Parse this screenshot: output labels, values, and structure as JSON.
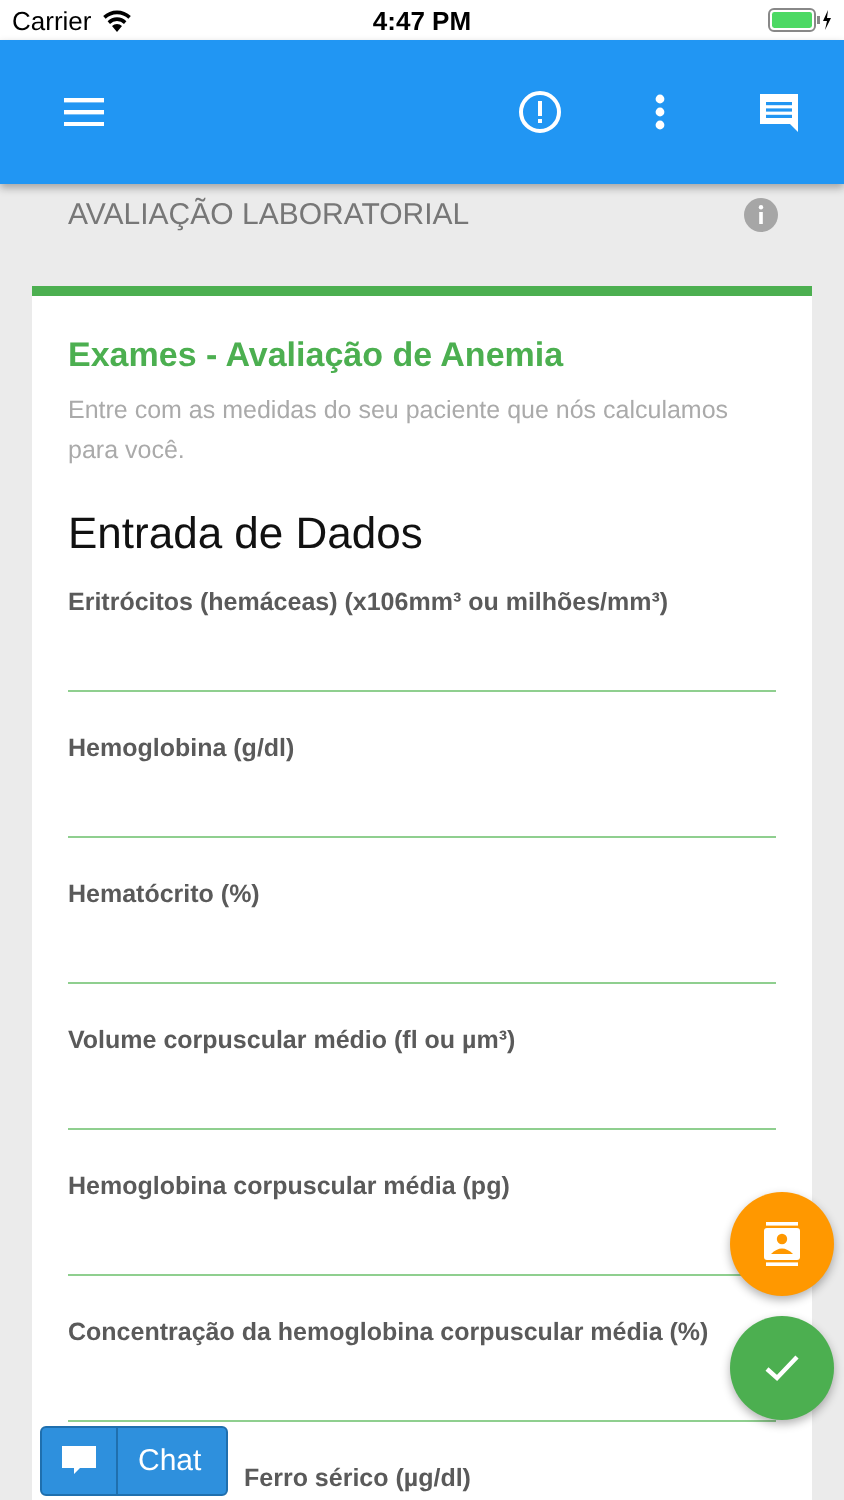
{
  "status_bar": {
    "carrier": "Carrier",
    "time": "4:47 PM"
  },
  "section": {
    "title": "AVALIAÇÃO LABORATORIAL"
  },
  "card": {
    "title": "Exames - Avaliação de Anemia",
    "description": "Entre com as medidas do seu paciente que nós calculamos para você.",
    "heading": "Entrada de Dados",
    "fields": [
      {
        "label": "Eritrócitos (hemáceas) (x106mm³ ou milhões/mm³)"
      },
      {
        "label": "Hemoglobina (g/dl)"
      },
      {
        "label": "Hematócrito (%)"
      },
      {
        "label": "Volume corpuscular médio (fl ou µm³)"
      },
      {
        "label": "Hemoglobina corpuscular média (pg)"
      },
      {
        "label": "Concentração da hemoglobina corpuscular média (%)"
      },
      {
        "label": "Ferro sérico (µg/dl)"
      }
    ]
  },
  "chat_button": {
    "label": "Chat"
  }
}
